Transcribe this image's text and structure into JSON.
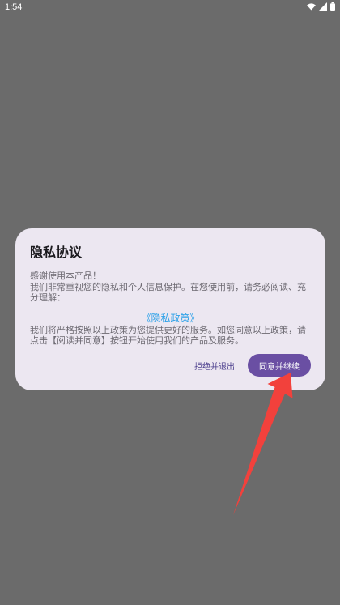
{
  "status_bar": {
    "time": "1:54",
    "icons": [
      "wifi-icon",
      "signal-icon",
      "battery-icon"
    ]
  },
  "dialog": {
    "title": "隐私协议",
    "line1": "感谢使用本产品！",
    "line2": "我们非常重视您的隐私和个人信息保护。在您使用前，请务必阅读、充分理解：",
    "policy_link": "《隐私政策》",
    "line3": "我们将严格按照以上政策为您提供更好的服务。如您同意以上政策，请点击【阅读并同意】按钮开始使用我们的产品及服务。",
    "reject_label": "拒绝并退出",
    "accept_label": "同意并继续"
  },
  "colors": {
    "scrim": "#6b6b6b",
    "dialog_bg": "#ece7f1",
    "accent": "#6a4fa3",
    "link": "#2aa0e8",
    "annotation_arrow": "#f2413c"
  }
}
